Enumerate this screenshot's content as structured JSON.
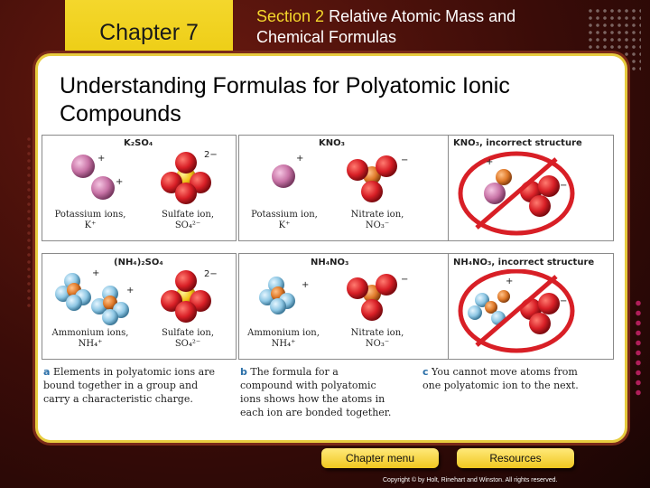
{
  "header": {
    "chapter_tab": "Chapter 7",
    "section_number": "Section 2",
    "section_title_line1": "Relative Atomic Mass and",
    "section_title_line2": "Chemical Formulas"
  },
  "slide_title_line1": "Understanding Formulas for Polyatomic Ionic",
  "slide_title_line2": "Compounds",
  "figure": {
    "top_row": {
      "left_formula": "K₂SO₄",
      "left_cation_caption": "Potassium ions,",
      "left_cation_symbol": "K⁺",
      "left_anion_caption": "Sulfate ion,",
      "left_anion_symbol": "SO₄²⁻",
      "middle_formula": "KNO₃",
      "middle_cation_caption": "Potassium ion,",
      "middle_cation_symbol": "K⁺",
      "middle_anion_caption": "Nitrate ion,",
      "middle_anion_symbol": "NO₃⁻",
      "right_formula": "KNO₃, incorrect structure"
    },
    "bottom_row": {
      "left_formula": "(NH₄)₂SO₄",
      "left_cation_caption": "Ammonium ions,",
      "left_cation_symbol": "NH₄⁺",
      "left_anion_caption": "Sulfate ion,",
      "left_anion_symbol": "SO₄²⁻",
      "middle_formula": "NH₄NO₃",
      "middle_cation_caption": "Ammonium ion,",
      "middle_cation_symbol": "NH₄⁺",
      "middle_anion_caption": "Nitrate ion,",
      "middle_anion_symbol": "NO₃⁻",
      "right_formula": "NH₄NO₃, incorrect structure"
    },
    "charges": {
      "plus": "+",
      "minus": "−",
      "two_minus": "2−"
    },
    "captions": {
      "a_letter": "a",
      "a_text": "Elements in polyatomic ions are bound together in a group and carry a characteristic charge.",
      "b_letter": "b",
      "b_text": "The formula for a compound with polyatomic ions shows how the atoms in each ion are bonded together.",
      "c_letter": "c",
      "c_text": "You cannot move atoms from one polyatomic ion to the next."
    }
  },
  "buttons": {
    "chapter_menu": "Chapter menu",
    "resources": "Resources"
  },
  "copyright": "Copyright © by Holt, Rinehart and Winston. All rights reserved.",
  "colors": {
    "background": "#3a0c08",
    "chapter_tab": "#f4d72c",
    "panel_border": "#e7cc3f",
    "oxygen": "#d81f26",
    "sulfur": "#f2c318",
    "potassium": "#c873a6",
    "nitrogen": "#e07a2a",
    "hydrogen": "#8ec7e4",
    "no_sign": "#d81f26"
  }
}
